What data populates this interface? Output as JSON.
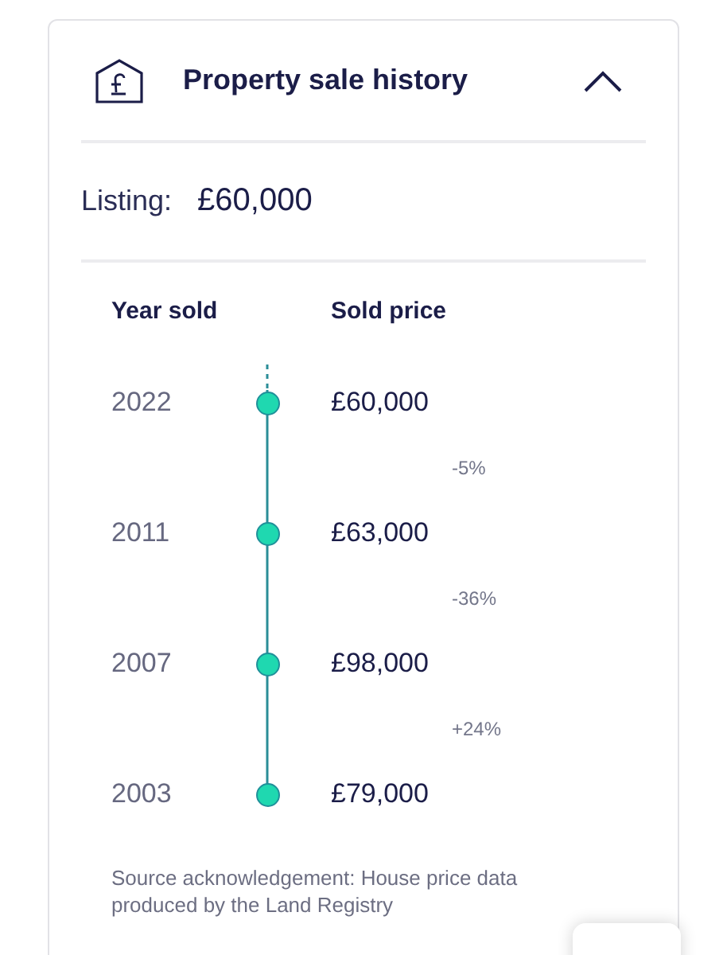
{
  "panel": {
    "title": "Property sale history",
    "expanded": true
  },
  "listing": {
    "label": "Listing:",
    "value": "£60,000"
  },
  "table": {
    "columns": [
      "Year sold",
      "Sold price"
    ],
    "rows": [
      {
        "year": "2022",
        "price": "£60,000",
        "change": "-5%"
      },
      {
        "year": "2011",
        "price": "£63,000",
        "change": "-36%"
      },
      {
        "year": "2007",
        "price": "£98,000",
        "change": "+24%"
      },
      {
        "year": "2003",
        "price": "£79,000"
      }
    ]
  },
  "source": "Source acknowledgement: House price data produced by the Land Registry"
}
